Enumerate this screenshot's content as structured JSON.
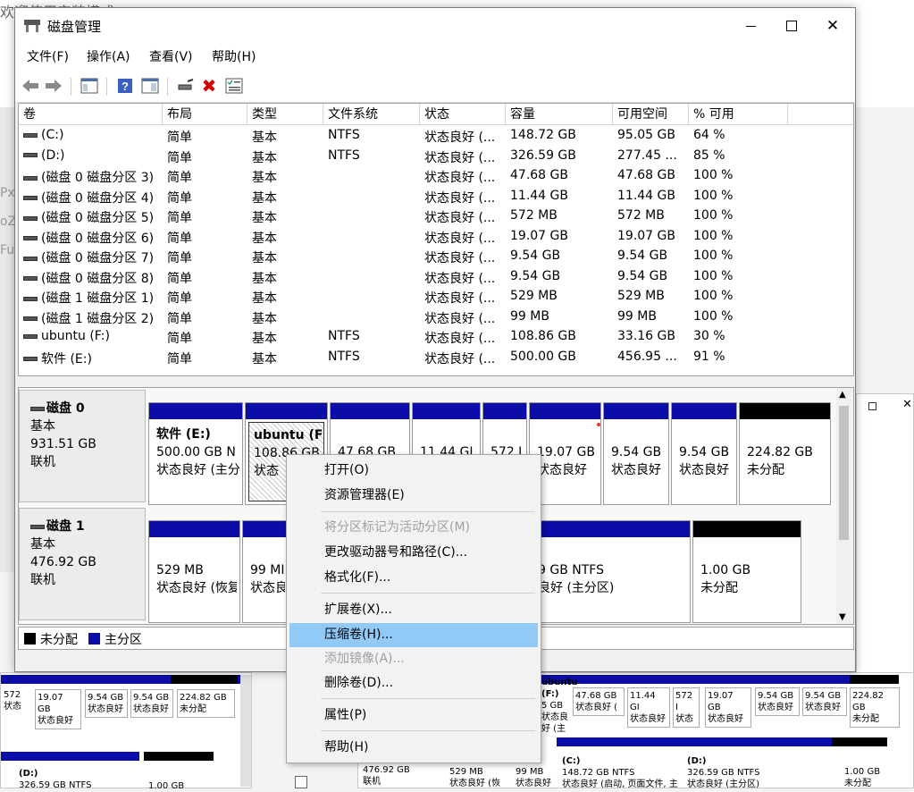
{
  "background": {
    "top_left_text": "欢迎使用安装模式",
    "side_letters": [
      "Px",
      "oZ",
      "Fu"
    ],
    "bottom_parts_left": [
      {
        "size": "572",
        "status": "状态"
      },
      {
        "size": "19.07 GB",
        "status": "状态良好"
      },
      {
        "size": "9.54 GB",
        "status": "状态良好"
      },
      {
        "size": "9.54 GB",
        "status": "状态良好"
      },
      {
        "size": "224.82 GB",
        "status": "未分配"
      }
    ],
    "bottom_disk_left": {
      "label": "(D:)",
      "size": "326.59 GB NTFS",
      "unalloc": "1.00 GB"
    },
    "bottom_parts_right": [
      {
        "name": "ubuntu (F:)",
        "size": "5 GB",
        "status": "状态良好 (主"
      },
      {
        "size": "47.68 GB",
        "status": "状态良好 ("
      },
      {
        "size": "11.44 GI",
        "status": "状态良好"
      },
      {
        "size": "572 I",
        "status": "状态"
      },
      {
        "size": "19.07 GB",
        "status": "状态良好"
      },
      {
        "size": "9.54 GB",
        "status": "状态良好"
      },
      {
        "size": "9.54 GB",
        "status": "状态良好"
      },
      {
        "size": "224.82 GB",
        "status": "未分配"
      }
    ],
    "bottom_disk_right": {
      "disk_size": "476.92 GB",
      "disk_state": "联机",
      "parts": [
        {
          "size": "529 MB",
          "status": "状态良好 (恢"
        },
        {
          "size": "99 MB",
          "status": "状态良好"
        },
        {
          "name": "(C:)",
          "size": "148.72 GB NTFS",
          "status": "状态良好 (启动, 页面文件, 主"
        },
        {
          "name": "(D:)",
          "size": "326.59 GB NTFS",
          "status": "状态良好 (主分区)"
        },
        {
          "size": "1.00 GB",
          "status": "未分配"
        }
      ]
    }
  },
  "window": {
    "title": "磁盘管理",
    "menu": [
      "文件(F)",
      "操作(A)",
      "查看(V)",
      "帮助(H)"
    ]
  },
  "columns": [
    "卷",
    "布局",
    "类型",
    "文件系统",
    "状态",
    "容量",
    "可用空间",
    "% 可用"
  ],
  "volumes": [
    {
      "name": "(C:)",
      "layout": "简单",
      "type": "基本",
      "fs": "NTFS",
      "status": "状态良好 (...",
      "capacity": "148.72 GB",
      "free": "95.05 GB",
      "pct": "64 %"
    },
    {
      "name": "(D:)",
      "layout": "简单",
      "type": "基本",
      "fs": "NTFS",
      "status": "状态良好 (...",
      "capacity": "326.59 GB",
      "free": "277.45 ...",
      "pct": "85 %"
    },
    {
      "name": "(磁盘 0 磁盘分区 3)",
      "layout": "简单",
      "type": "基本",
      "fs": "",
      "status": "状态良好 (...",
      "capacity": "47.68 GB",
      "free": "47.68 GB",
      "pct": "100 %"
    },
    {
      "name": "(磁盘 0 磁盘分区 4)",
      "layout": "简单",
      "type": "基本",
      "fs": "",
      "status": "状态良好 (...",
      "capacity": "11.44 GB",
      "free": "11.44 GB",
      "pct": "100 %"
    },
    {
      "name": "(磁盘 0 磁盘分区 5)",
      "layout": "简单",
      "type": "基本",
      "fs": "",
      "status": "状态良好 (...",
      "capacity": "572 MB",
      "free": "572 MB",
      "pct": "100 %"
    },
    {
      "name": "(磁盘 0 磁盘分区 6)",
      "layout": "简单",
      "type": "基本",
      "fs": "",
      "status": "状态良好 (...",
      "capacity": "19.07 GB",
      "free": "19.07 GB",
      "pct": "100 %"
    },
    {
      "name": "(磁盘 0 磁盘分区 7)",
      "layout": "简单",
      "type": "基本",
      "fs": "",
      "status": "状态良好 (...",
      "capacity": "9.54 GB",
      "free": "9.54 GB",
      "pct": "100 %"
    },
    {
      "name": "(磁盘 0 磁盘分区 8)",
      "layout": "简单",
      "type": "基本",
      "fs": "",
      "status": "状态良好 (...",
      "capacity": "9.54 GB",
      "free": "9.54 GB",
      "pct": "100 %"
    },
    {
      "name": "(磁盘 1 磁盘分区 1)",
      "layout": "简单",
      "type": "基本",
      "fs": "",
      "status": "状态良好 (...",
      "capacity": "529 MB",
      "free": "529 MB",
      "pct": "100 %"
    },
    {
      "name": "(磁盘 1 磁盘分区 2)",
      "layout": "简单",
      "type": "基本",
      "fs": "",
      "status": "状态良好 (...",
      "capacity": "99 MB",
      "free": "99 MB",
      "pct": "100 %"
    },
    {
      "name": "ubuntu (F:)",
      "layout": "简单",
      "type": "基本",
      "fs": "NTFS",
      "status": "状态良好 (...",
      "capacity": "108.86 GB",
      "free": "33.16 GB",
      "pct": "30 %"
    },
    {
      "name": "软件 (E:)",
      "layout": "简单",
      "type": "基本",
      "fs": "NTFS",
      "status": "状态良好 (...",
      "capacity": "500.00 GB",
      "free": "456.95 ...",
      "pct": "91 %"
    }
  ],
  "disk0": {
    "label": "磁盘 0",
    "type": "基本",
    "size": "931.51 GB",
    "state": "联机",
    "parts": [
      {
        "name": "软件  (E:)",
        "line1": "500.00 GB N",
        "line2": "状态良好 (主分"
      },
      {
        "name": "ubuntu  (F",
        "line1": "108.86 GB",
        "line2": "状态"
      },
      {
        "name": "",
        "line1": "47.68 GB",
        "line2": ""
      },
      {
        "name": "",
        "line1": "11.44 GI",
        "line2": ""
      },
      {
        "name": "",
        "line1": "572 I",
        "line2": ""
      },
      {
        "name": "",
        "line1": "19.07 GB",
        "line2": "状态良好"
      },
      {
        "name": "",
        "line1": "9.54 GB",
        "line2": "状态良好"
      },
      {
        "name": "",
        "line1": "9.54 GB",
        "line2": "状态良好"
      },
      {
        "name": "",
        "line1": "224.82 GB",
        "line2": "未分配"
      }
    ]
  },
  "disk1": {
    "label": "磁盘 1",
    "type": "基本",
    "size": "476.92 GB",
    "state": "联机",
    "parts": [
      {
        "line1": "529 MB",
        "line2": "状态良好 (恢复"
      },
      {
        "line1": "99 MI",
        "line2": "状态良"
      },
      {
        "line1": "9 GB NTFS",
        "line2": "良好 (主分区)"
      },
      {
        "line1": "1.00 GB",
        "line2": "未分配"
      }
    ]
  },
  "legend": {
    "unallocated": "未分配",
    "primary": "主分区"
  },
  "context_menu": [
    {
      "label": "打开(O)",
      "enabled": true
    },
    {
      "label": "资源管理器(E)",
      "enabled": true
    },
    {
      "label": "将分区标记为活动分区(M)",
      "enabled": false
    },
    {
      "label": "更改驱动器号和路径(C)...",
      "enabled": true
    },
    {
      "label": "格式化(F)...",
      "enabled": true
    },
    {
      "label": "扩展卷(X)...",
      "enabled": true
    },
    {
      "label": "压缩卷(H)...",
      "enabled": true,
      "highlighted": true
    },
    {
      "label": "添加镜像(A)...",
      "enabled": false
    },
    {
      "label": "删除卷(D)...",
      "enabled": true
    },
    {
      "label": "属性(P)",
      "enabled": true
    },
    {
      "label": "帮助(H)",
      "enabled": true
    }
  ],
  "colors": {
    "primary_partition": "#0c0ca8",
    "unallocated": "#000000",
    "menu_highlight": "#91c9f7",
    "close_x": "#d40000"
  }
}
